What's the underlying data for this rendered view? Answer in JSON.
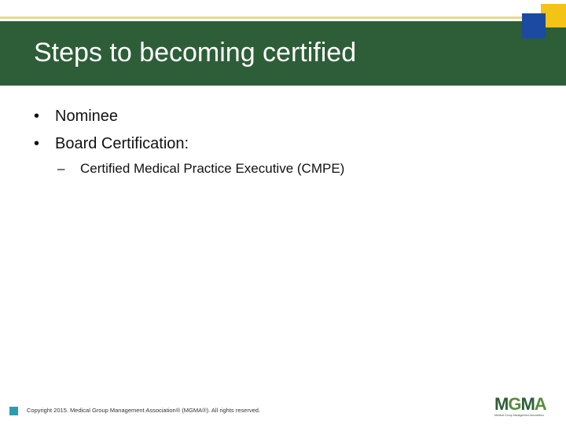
{
  "slide": {
    "title": "Steps to becoming certified",
    "bullets": [
      {
        "mark": "•",
        "text": "Nominee"
      },
      {
        "mark": "•",
        "text": "Board Certification:"
      }
    ],
    "sub_bullets": [
      {
        "mark": "–",
        "text": "Certified Medical Practice Executive (CMPE)"
      }
    ]
  },
  "footer": {
    "copyright": "Copyright 2015. Medical Group Management Association® (MGMA®). All rights reserved."
  },
  "logo": {
    "letters": "MGMA",
    "tagline": "Medical Group Management Association"
  },
  "colors": {
    "title_bar": "#2d5e38",
    "accent_line": "#e3dc8c",
    "corner_yellow": "#f3c318",
    "corner_blue": "#1c4aa0",
    "footer_square": "#2a9db3"
  }
}
